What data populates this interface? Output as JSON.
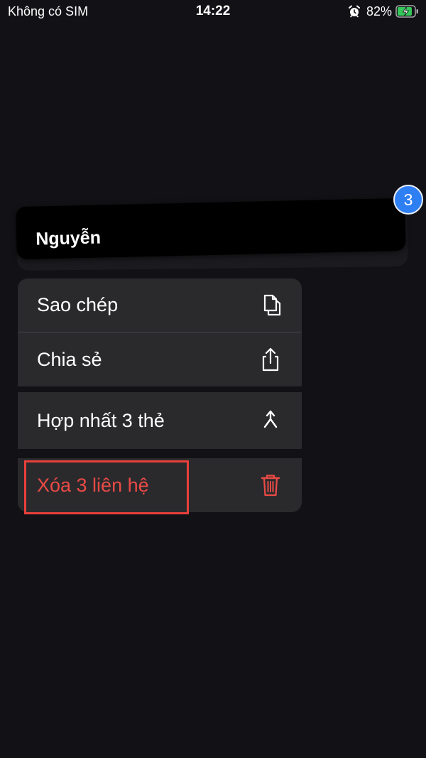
{
  "status_bar": {
    "carrier": "Không có SIM",
    "time": "14:22",
    "battery_percent": "82%",
    "icons": [
      "alarm-icon",
      "battery-charging-icon"
    ]
  },
  "contact_card": {
    "name": "Nguyễn",
    "badge_count": "3",
    "badge_color": "#2f7ff4"
  },
  "menu": {
    "copy_label": "Sao chép",
    "share_label": "Chia sẻ",
    "merge_label": "Hợp nhất 3 thẻ",
    "delete_label": "Xóa 3 liên hệ",
    "danger_color": "#eb4a45",
    "icons": [
      "copy-icon",
      "share-icon",
      "merge-icon",
      "trash-icon"
    ]
  },
  "colors": {
    "background": "#121216",
    "menu_background": "#2a2a2d",
    "highlight": "#e8403c"
  }
}
